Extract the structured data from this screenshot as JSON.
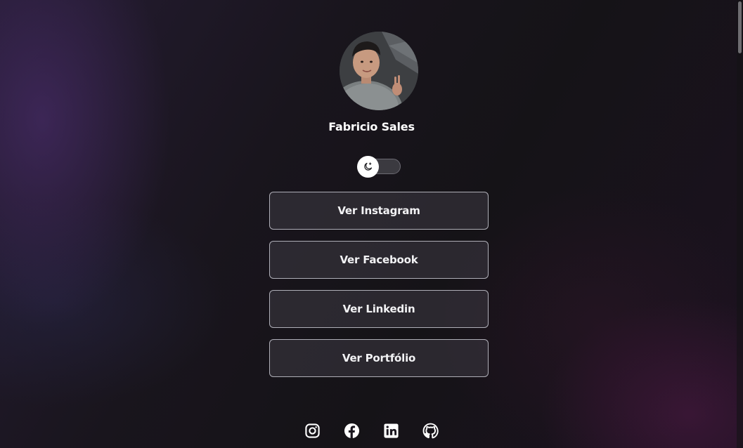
{
  "profile": {
    "name": "Fabricio Sales",
    "avatar_icon": "profile-photo"
  },
  "theme_toggle": {
    "icon": "moon-icon",
    "state": "dark"
  },
  "links": [
    {
      "label": "Ver Instagram"
    },
    {
      "label": "Ver Facebook"
    },
    {
      "label": "Ver Linkedin"
    },
    {
      "label": "Ver Portfólio"
    }
  ],
  "social_icons": [
    "instagram-icon",
    "facebook-icon",
    "linkedin-icon",
    "github-icon"
  ],
  "colors": {
    "text": "#ffffff",
    "button_border": "#dcdce6",
    "button_bg": "#3e3a44",
    "accent_purple": "#523078"
  }
}
